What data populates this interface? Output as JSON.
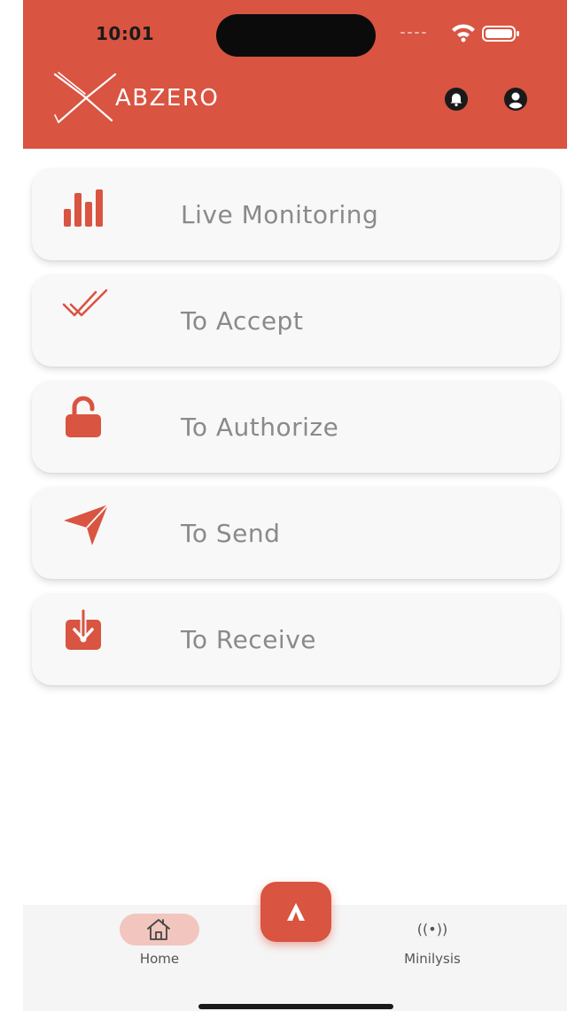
{
  "status_bar": {
    "time": "10:01"
  },
  "header": {
    "brand": "ABZERO",
    "icons": [
      "logo-x-icon",
      "bell-icon",
      "user-circle-icon"
    ]
  },
  "menu": [
    {
      "label": "Live Monitoring",
      "icon": "bar-chart-icon"
    },
    {
      "label": "To Accept",
      "icon": "double-check-icon"
    },
    {
      "label": "To Authorize",
      "icon": "unlock-icon"
    },
    {
      "label": "To Send",
      "icon": "paper-plane-icon"
    },
    {
      "label": "To Receive",
      "icon": "download-box-icon"
    }
  ],
  "tabbar": {
    "home_label": "Home",
    "mini_label": "Minilysis",
    "mini_glyph": "((•))",
    "active_tab": "Home"
  },
  "colors": {
    "accent": "#d95441",
    "label_gray": "#8a8a8a",
    "card_bg": "#f8f8f8",
    "home_pill": "#f2c6bf"
  }
}
